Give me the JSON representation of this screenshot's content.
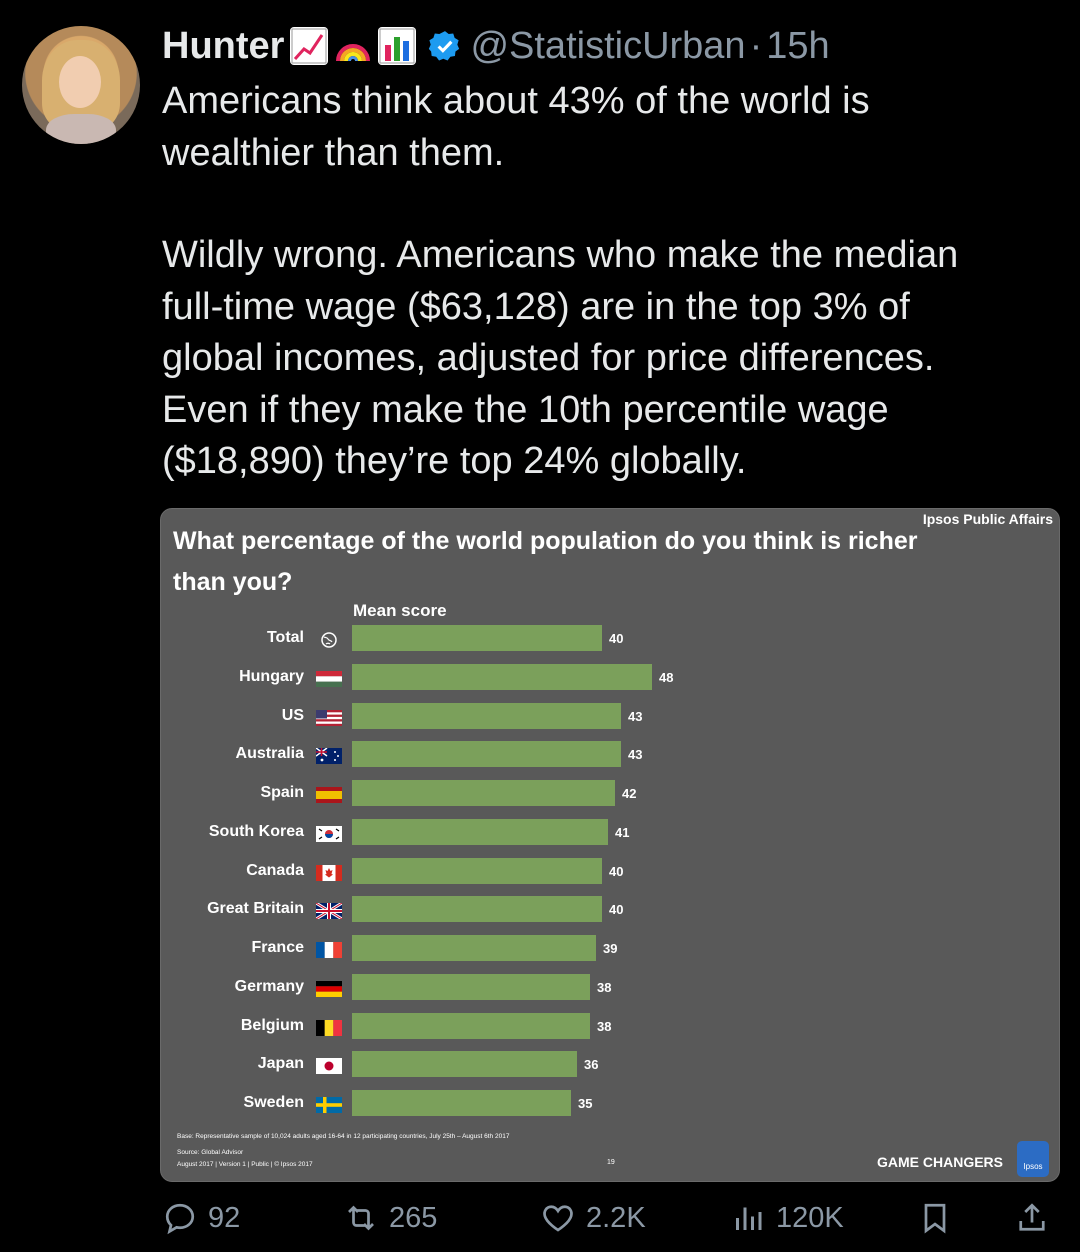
{
  "post": {
    "author_name": "Hunter",
    "author_emojis": [
      "chart-increasing-emoji",
      "rainbow-emoji",
      "bar-chart-emoji"
    ],
    "handle": "@StatisticUrban",
    "separator": "·",
    "time": "15h",
    "text_p1_line1": "Americans think about 43% of the world is",
    "text_p1_line2": "wealthier than them.",
    "text_p2_line1": "Wildly wrong. Americans who make the median",
    "text_p2_line2": "full-time wage ($63,128) are in the top 3% of",
    "text_p2_line3": "global incomes, adjusted for price differences.",
    "text_p2_line4": "Even if they make the 10th percentile wage",
    "text_p2_line5": "($18,890) they’re top 24% globally."
  },
  "chart_card": {
    "brand_top": "Ipsos Public Affairs",
    "footer_base": "Base: Representative sample of 10,024 adults aged 16-64 in 12 participating countries, July 25th – August 6th 2017",
    "footer_source": "Source: Global Advisor",
    "footer_version": "August 2017 | Version 1 | Public | © Ipsos 2017",
    "page_number": "19",
    "game_changers": "GAME CHANGERS",
    "logo_text": "Ipsos"
  },
  "chart_data": {
    "type": "bar",
    "orientation": "horizontal",
    "title": "What percentage of the world population do you think is richer than you?",
    "subtitle": "Mean score",
    "categories": [
      "Total",
      "Hungary",
      "US",
      "Australia",
      "Spain",
      "South Korea",
      "Canada",
      "Great Britain",
      "France",
      "Germany",
      "Belgium",
      "Japan",
      "Sweden"
    ],
    "values": [
      40,
      48,
      43,
      43,
      42,
      41,
      40,
      40,
      39,
      38,
      38,
      36,
      35
    ],
    "bar_color": "#7ba05b",
    "xlim": [
      0,
      48
    ]
  },
  "actions": {
    "replies": "92",
    "reposts": "265",
    "likes": "2.2K",
    "views": "120K"
  },
  "colors": {
    "background": "#000000",
    "text": "#e7e9ea",
    "muted": "#8b98a5",
    "verified": "#1d9bf0",
    "card_bg": "#595959"
  }
}
